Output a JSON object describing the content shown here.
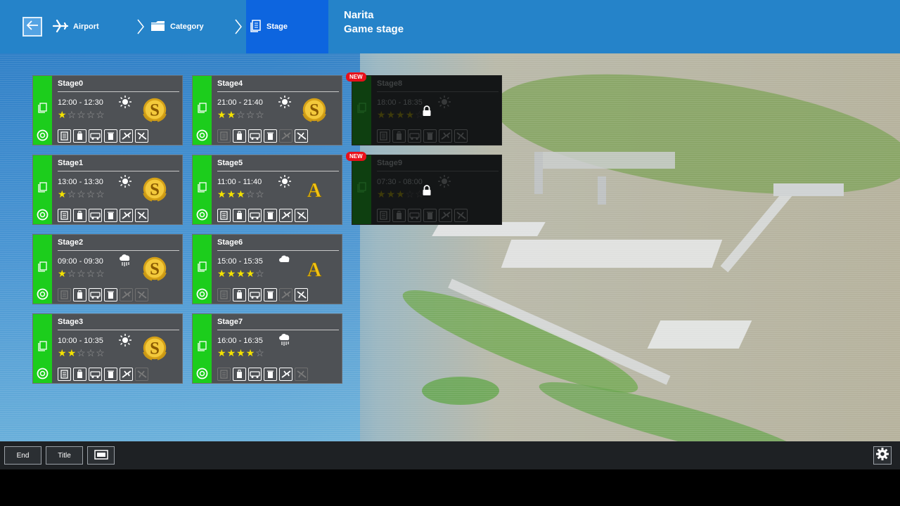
{
  "breadcrumb": {
    "airport": "Airport",
    "category": "Category",
    "stage": "Stage"
  },
  "location": {
    "name": "Narita",
    "subtitle": "Game stage"
  },
  "icons": {
    "back": "back-arrow-icon",
    "airport": "airplane-icon",
    "category": "folder-icon",
    "stage": "document-icon",
    "settings": "gear-icon",
    "screen": "fullscreen-icon",
    "lock": "lock-icon"
  },
  "colors": {
    "topbar": "#2583c9",
    "active_crumb": "#0d65df",
    "stage_strip": "#1ccd1c",
    "star": "#f4e200",
    "new_badge": "#e8101a"
  },
  "new_badge_label": "NEW",
  "stages": [
    {
      "name": "Stage0",
      "time": "12:00 - 12:30",
      "stars": 1,
      "weather": "sun",
      "rank": "S",
      "locked": false,
      "new": false,
      "missions": [
        true,
        true,
        true,
        true,
        true,
        true
      ]
    },
    {
      "name": "Stage1",
      "time": "13:00 - 13:30",
      "stars": 1,
      "weather": "sun",
      "rank": "S",
      "locked": false,
      "new": false,
      "missions": [
        true,
        true,
        true,
        true,
        true,
        true
      ]
    },
    {
      "name": "Stage2",
      "time": "09:00 - 09:30",
      "stars": 1,
      "weather": "rain",
      "rank": "S",
      "locked": false,
      "new": false,
      "missions": [
        false,
        true,
        true,
        true,
        false,
        false
      ]
    },
    {
      "name": "Stage3",
      "time": "10:00 - 10:35",
      "stars": 2,
      "weather": "sun",
      "rank": "S",
      "locked": false,
      "new": false,
      "missions": [
        true,
        true,
        true,
        true,
        true,
        false
      ]
    },
    {
      "name": "Stage4",
      "time": "21:00 - 21:40",
      "stars": 2,
      "weather": "sun",
      "rank": "S",
      "locked": false,
      "new": false,
      "missions": [
        false,
        true,
        true,
        true,
        false,
        true
      ]
    },
    {
      "name": "Stage5",
      "time": "11:00 - 11:40",
      "stars": 3,
      "weather": "sun",
      "rank": "A",
      "locked": false,
      "new": false,
      "missions": [
        true,
        true,
        true,
        true,
        true,
        true
      ]
    },
    {
      "name": "Stage6",
      "time": "15:00 - 15:35",
      "stars": 4,
      "weather": "cloud",
      "rank": "A",
      "locked": false,
      "new": false,
      "missions": [
        false,
        true,
        true,
        true,
        false,
        true
      ]
    },
    {
      "name": "Stage7",
      "time": "16:00 - 16:35",
      "stars": 4,
      "weather": "rain",
      "rank": "",
      "locked": false,
      "new": false,
      "missions": [
        false,
        true,
        true,
        true,
        true,
        false
      ]
    },
    {
      "name": "Stage8",
      "time": "18:00 - 18:35",
      "stars": 4,
      "weather": "sun",
      "rank": "",
      "locked": true,
      "new": true,
      "missions": [
        true,
        true,
        true,
        true,
        true,
        true
      ]
    },
    {
      "name": "Stage9",
      "time": "07:30 - 08:00",
      "stars": 3,
      "weather": "sun",
      "rank": "",
      "locked": true,
      "new": true,
      "missions": [
        true,
        true,
        true,
        true,
        true,
        true
      ]
    }
  ],
  "bottom": {
    "end": "End",
    "title": "Title"
  }
}
